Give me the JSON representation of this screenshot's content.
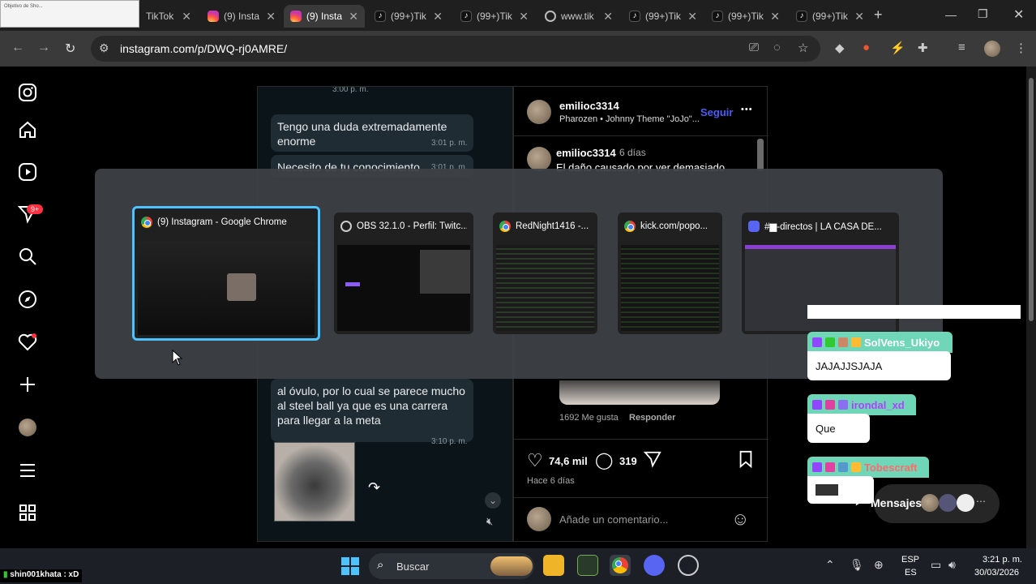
{
  "browser": {
    "tabs": [
      {
        "label": "TikTok",
        "icon": "tiktok-icon"
      },
      {
        "label": "(9) Insta",
        "icon": "instagram-icon"
      },
      {
        "label": "(9) Insta",
        "icon": "instagram-icon",
        "active": true
      },
      {
        "label": "(99+)Tik",
        "icon": "tiktok-icon"
      },
      {
        "label": "(99+)Tik",
        "icon": "tiktok-icon"
      },
      {
        "label": "www.tik",
        "icon": "globe-icon"
      },
      {
        "label": "(99+)Tik",
        "icon": "tiktok-icon"
      },
      {
        "label": "(99+)Tik",
        "icon": "tiktok-icon"
      },
      {
        "label": "(99+)Tik",
        "icon": "tiktok-icon"
      }
    ],
    "url": "instagram.com/p/DWQ-rj0AMRE/",
    "thumbnail_text": "Objetivo de Sho...",
    "new_tab": "+"
  },
  "sidebar": {
    "notifications_badge": "9+"
  },
  "chat": {
    "time_top": "3:00 p. m.",
    "messages": [
      {
        "text": "Tengo una duda extremadamente enorme",
        "time": "3:01 p. m."
      },
      {
        "text": "Necesito de tu conocimiento",
        "time": "3:01 p. m."
      },
      {
        "text": "al óvulo, por lo cual se parece mucho al steel ball ya que es una carrera para llegar a la meta",
        "time": "3:10 p. m."
      }
    ]
  },
  "post": {
    "author": "emilioc3314",
    "subtitle": "Pharozen • Johnny Theme \"JoJo\"...",
    "follow_label": "Seguir",
    "more": "•••",
    "caption_author": "emilioc3314",
    "caption_age": "6 días",
    "caption_text": "El daño causado por ver demasiado",
    "reply_likes": "1692 Me gusta",
    "reply_label": "Responder",
    "likes": "74,6 mil",
    "comments": "319",
    "date": "Hace 6 días",
    "comment_placeholder": "Añade un comentario..."
  },
  "switcher": {
    "windows": [
      {
        "title": "(9) Instagram - Google Chrome",
        "icon": "chrome-icon"
      },
      {
        "title": "OBS 32.1.0 - Perfil: Twitc...",
        "icon": "obs-icon"
      },
      {
        "title": "RedNight1416 -...",
        "icon": "chrome-icon"
      },
      {
        "title": "kick.com/popo...",
        "icon": "chrome-icon"
      },
      {
        "title": "#▆-directos | LA CASA DE...",
        "icon": "discord-icon"
      }
    ]
  },
  "overlay_chat": [
    {
      "user": "SolVens_Ukiyo",
      "message": "JAJAJJSJAJA"
    },
    {
      "user": "irondal_xd",
      "message": "Que"
    },
    {
      "user": "Tobescraft",
      "message": ""
    }
  ],
  "messages_panel": {
    "label": "Mensajes"
  },
  "bottom_overlay": {
    "text": "shin001khata : xD"
  },
  "taskbar": {
    "search": "Buscar",
    "lang1": "ESP",
    "lang2": "ES",
    "time": "3:21 p. m.",
    "date": "30/03/2026"
  },
  "colors": {
    "accent": "#4cc2ff",
    "follow": "#4a5df9",
    "twitch_name_bg": "#6fd6b8",
    "badge": "#ff3040"
  }
}
